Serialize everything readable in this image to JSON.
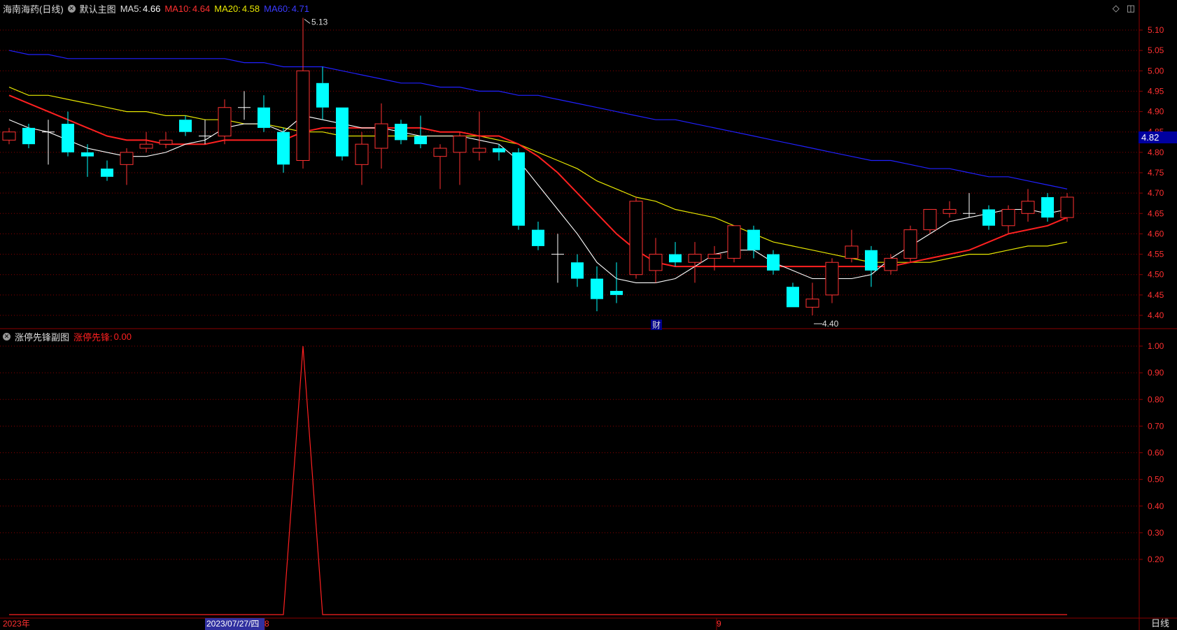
{
  "main_header": {
    "stock_name": "海南海药(日线)",
    "template": "默认主图",
    "ma5_label": "MA5:",
    "ma5_value": "4.66",
    "ma10_label": "MA10:",
    "ma10_value": "4.64",
    "ma20_label": "MA20:",
    "ma20_value": "4.58",
    "ma60_label": "MA60:",
    "ma60_value": "4.71"
  },
  "sub_header": {
    "title": "涨停先锋副图",
    "indicator_label": "涨停先锋:",
    "indicator_value": "0.00"
  },
  "price_tag": "4.82",
  "high_label": "5.13",
  "low_label": "4.40",
  "event_marker": "财",
  "x_axis": {
    "year_label": "2023年",
    "selected_date": "2023/07/27/四",
    "month_8": "8",
    "month_9": "9"
  },
  "period_button": "日线",
  "colors": {
    "up": "#ff3232",
    "down": "#00ffff",
    "ma5": "#ffffff",
    "ma10": "#ff2020",
    "ma20": "#e6e600",
    "ma60": "#2020ff",
    "grid": "#8b0000"
  },
  "chart_data": [
    {
      "type": "candlestick",
      "ylim": [
        4.36,
        5.14
      ],
      "y_ticks": [
        "5.10",
        "5.05",
        "5.00",
        "4.95",
        "4.90",
        "4.85",
        "4.80",
        "4.75",
        "4.70",
        "4.65",
        "4.60",
        "4.55",
        "4.50",
        "4.45",
        "4.40"
      ],
      "candles": [
        [
          4.83,
          4.85,
          4.82,
          4.86
        ],
        [
          4.86,
          4.82,
          4.81,
          4.87
        ],
        [
          4.85,
          4.85,
          4.77,
          4.88
        ],
        [
          4.87,
          4.8,
          4.79,
          4.9
        ],
        [
          4.8,
          4.79,
          4.74,
          4.82
        ],
        [
          4.76,
          4.74,
          4.73,
          4.78
        ],
        [
          4.77,
          4.8,
          4.72,
          4.81
        ],
        [
          4.81,
          4.82,
          4.8,
          4.85
        ],
        [
          4.82,
          4.83,
          4.81,
          4.85
        ],
        [
          4.88,
          4.85,
          4.84,
          4.89
        ],
        [
          4.84,
          4.84,
          4.82,
          4.88
        ],
        [
          4.84,
          4.91,
          4.82,
          4.93
        ],
        [
          4.91,
          4.91,
          4.88,
          4.95
        ],
        [
          4.91,
          4.86,
          4.85,
          4.94
        ],
        [
          4.85,
          4.77,
          4.75,
          4.86
        ],
        [
          4.78,
          5.0,
          4.76,
          5.13
        ],
        [
          4.97,
          4.91,
          4.88,
          5.01
        ],
        [
          4.91,
          4.79,
          4.78,
          4.91
        ],
        [
          4.77,
          4.82,
          4.72,
          4.85
        ],
        [
          4.81,
          4.87,
          4.76,
          4.92
        ],
        [
          4.87,
          4.83,
          4.82,
          4.88
        ],
        [
          4.84,
          4.82,
          4.81,
          4.89
        ],
        [
          4.79,
          4.81,
          4.71,
          4.82
        ],
        [
          4.8,
          4.84,
          4.72,
          4.85
        ],
        [
          4.8,
          4.81,
          4.78,
          4.9
        ],
        [
          4.81,
          4.8,
          4.78,
          4.82
        ],
        [
          4.8,
          4.62,
          4.61,
          4.81
        ],
        [
          4.61,
          4.57,
          4.56,
          4.63
        ],
        [
          4.55,
          4.55,
          4.48,
          4.6
        ],
        [
          4.53,
          4.49,
          4.47,
          4.55
        ],
        [
          4.49,
          4.44,
          4.41,
          4.52
        ],
        [
          4.46,
          4.45,
          4.43,
          4.53
        ],
        [
          4.5,
          4.68,
          4.49,
          4.69
        ],
        [
          4.51,
          4.55,
          4.48,
          4.59
        ],
        [
          4.55,
          4.53,
          4.52,
          4.58
        ],
        [
          4.53,
          4.55,
          4.48,
          4.58
        ],
        [
          4.54,
          4.55,
          4.51,
          4.57
        ],
        [
          4.54,
          4.62,
          4.53,
          4.62
        ],
        [
          4.61,
          4.56,
          4.54,
          4.62
        ],
        [
          4.55,
          4.51,
          4.5,
          4.56
        ],
        [
          4.47,
          4.42,
          4.42,
          4.48
        ],
        [
          4.42,
          4.44,
          4.4,
          4.48
        ],
        [
          4.45,
          4.53,
          4.43,
          4.54
        ],
        [
          4.54,
          4.57,
          4.53,
          4.61
        ],
        [
          4.56,
          4.51,
          4.47,
          4.57
        ],
        [
          4.51,
          4.54,
          4.5,
          4.55
        ],
        [
          4.54,
          4.61,
          4.53,
          4.62
        ],
        [
          4.61,
          4.66,
          4.6,
          4.66
        ],
        [
          4.65,
          4.66,
          4.64,
          4.68
        ],
        [
          4.65,
          4.65,
          4.64,
          4.7
        ],
        [
          4.66,
          4.62,
          4.61,
          4.67
        ],
        [
          4.62,
          4.66,
          4.6,
          4.67
        ],
        [
          4.65,
          4.68,
          4.63,
          4.71
        ],
        [
          4.69,
          4.64,
          4.63,
          4.7
        ],
        [
          4.64,
          4.69,
          4.63,
          4.7
        ]
      ],
      "ma5": [
        4.88,
        4.86,
        4.85,
        4.83,
        4.81,
        4.8,
        4.79,
        4.79,
        4.8,
        4.82,
        4.83,
        4.86,
        4.87,
        4.87,
        4.85,
        4.89,
        4.88,
        4.87,
        4.86,
        4.86,
        4.85,
        4.84,
        4.84,
        4.84,
        4.83,
        4.82,
        4.78,
        4.72,
        4.66,
        4.6,
        4.53,
        4.49,
        4.48,
        4.48,
        4.49,
        4.52,
        4.55,
        4.56,
        4.56,
        4.53,
        4.51,
        4.49,
        4.49,
        4.49,
        4.5,
        4.54,
        4.57,
        4.6,
        4.63,
        4.64,
        4.65,
        4.66,
        4.66,
        4.65,
        4.66
      ],
      "ma10": [
        4.94,
        4.92,
        4.9,
        4.88,
        4.86,
        4.84,
        4.83,
        4.83,
        4.82,
        4.82,
        4.82,
        4.83,
        4.83,
        4.83,
        4.83,
        4.85,
        4.86,
        4.86,
        4.86,
        4.86,
        4.86,
        4.86,
        4.85,
        4.85,
        4.84,
        4.84,
        4.82,
        4.79,
        4.75,
        4.7,
        4.65,
        4.6,
        4.56,
        4.53,
        4.52,
        4.52,
        4.52,
        4.52,
        4.52,
        4.52,
        4.52,
        4.52,
        4.52,
        4.52,
        4.52,
        4.52,
        4.53,
        4.54,
        4.55,
        4.56,
        4.58,
        4.6,
        4.61,
        4.62,
        4.64
      ],
      "ma20": [
        4.96,
        4.94,
        4.94,
        4.93,
        4.92,
        4.91,
        4.9,
        4.9,
        4.89,
        4.89,
        4.88,
        4.88,
        4.87,
        4.87,
        4.86,
        4.85,
        4.85,
        4.84,
        4.84,
        4.84,
        4.84,
        4.84,
        4.84,
        4.84,
        4.84,
        4.83,
        4.82,
        4.8,
        4.78,
        4.76,
        4.73,
        4.71,
        4.69,
        4.68,
        4.66,
        4.65,
        4.64,
        4.62,
        4.6,
        4.58,
        4.57,
        4.56,
        4.55,
        4.54,
        4.53,
        4.53,
        4.53,
        4.53,
        4.54,
        4.55,
        4.55,
        4.56,
        4.57,
        4.57,
        4.58
      ],
      "ma60": [
        5.05,
        5.04,
        5.04,
        5.03,
        5.03,
        5.03,
        5.03,
        5.03,
        5.03,
        5.03,
        5.03,
        5.03,
        5.02,
        5.02,
        5.01,
        5.01,
        5.01,
        5.0,
        4.99,
        4.98,
        4.97,
        4.97,
        4.96,
        4.96,
        4.95,
        4.95,
        4.94,
        4.94,
        4.93,
        4.92,
        4.91,
        4.9,
        4.89,
        4.88,
        4.88,
        4.87,
        4.86,
        4.85,
        4.84,
        4.83,
        4.82,
        4.81,
        4.8,
        4.79,
        4.78,
        4.78,
        4.77,
        4.76,
        4.76,
        4.75,
        4.74,
        4.74,
        4.73,
        4.72,
        4.71
      ]
    },
    {
      "type": "line",
      "title": "涨停先锋副图",
      "ylim": [
        0.1,
        1.05
      ],
      "y_ticks": [
        "1.00",
        "0.90",
        "0.80",
        "0.70",
        "0.60",
        "0.50",
        "0.40",
        "0.30",
        "0.20"
      ],
      "series": [
        {
          "name": "涨停先锋",
          "values": [
            0,
            0,
            0,
            0,
            0,
            0,
            0,
            0,
            0,
            0,
            0,
            0,
            0,
            0,
            0,
            1,
            0,
            0,
            0,
            0,
            0,
            0,
            0,
            0,
            0,
            0,
            0,
            0,
            0,
            0,
            0,
            0,
            0,
            0,
            0,
            0,
            0,
            0,
            0,
            0,
            0,
            0,
            0,
            0,
            0,
            0,
            0,
            0,
            0,
            0,
            0,
            0,
            0,
            0,
            0
          ]
        }
      ]
    }
  ]
}
